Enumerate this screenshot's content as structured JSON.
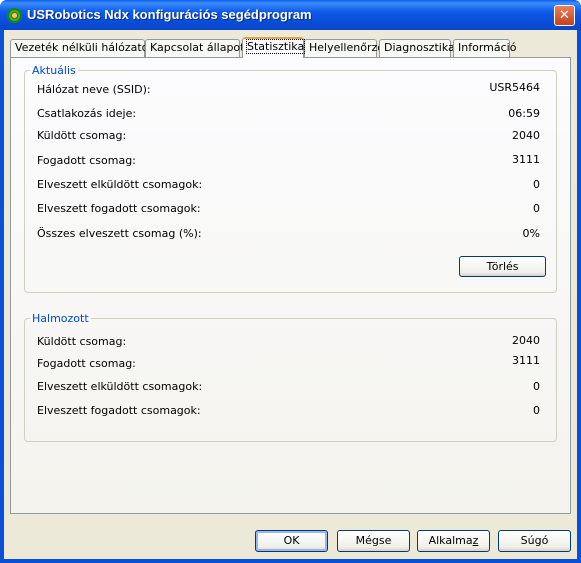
{
  "window": {
    "title": "USRobotics Ndx konfigurációs segédprogram",
    "close_glyph": "✕"
  },
  "tabs": [
    {
      "label": "Vezeték nélküli hálózatok",
      "active": false
    },
    {
      "label": "Kapcsolat állapota",
      "active": false
    },
    {
      "label": "Statisztika",
      "active": true
    },
    {
      "label": "Helyellenőrző",
      "active": false
    },
    {
      "label": "Diagnosztika",
      "active": false
    },
    {
      "label": "Információ",
      "active": false
    }
  ],
  "current": {
    "legend": "Aktuális",
    "ssid_label": "Hálózat neve (SSID):",
    "ssid_value": "USR5464",
    "time_label": "Csatlakozás ideje:",
    "time_value": "06:59",
    "sent_label": "Küldött csomag:",
    "sent_value": "2040",
    "recv_label": "Fogadott csomag:",
    "recv_value": "3111",
    "lost_sent_label": "Elveszett elküldött csomagok:",
    "lost_sent_value": "0",
    "lost_recv_label": "Elveszett fogadott csomagok:",
    "lost_recv_value": "0",
    "lost_total_label": "Összes elveszett csomag (%):",
    "lost_total_value": "0%",
    "clear_button": "Törlés"
  },
  "cumulative": {
    "legend": "Halmozott",
    "sent_label": "Küldött csomag:",
    "sent_value": "2040",
    "recv_label": "Fogadott csomag:",
    "recv_value": "3111",
    "lost_sent_label": "Elveszett elküldött csomagok:",
    "lost_sent_value": "0",
    "lost_recv_label": "Elveszett fogadott csomagok:",
    "lost_recv_value": "0"
  },
  "buttons": {
    "ok": "OK",
    "cancel": "Mégse",
    "apply_prefix": "Alkalma",
    "apply_mnemonic": "z",
    "help": "Súgó"
  },
  "icons": {
    "app": "usrobotics-app-icon"
  },
  "colors": {
    "titlebar": "#0a54e4",
    "legend": "#0046d5",
    "client": "#ece9d8"
  }
}
